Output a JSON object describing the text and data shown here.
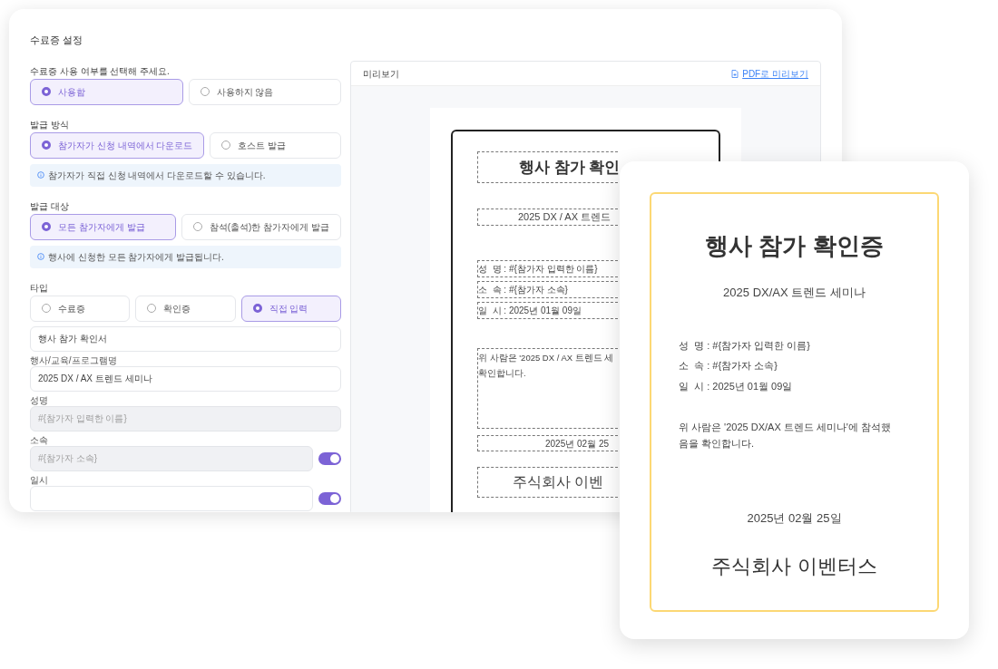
{
  "settings": {
    "title": "수료증 설정",
    "usage": {
      "label": "수료증 사용 여부를 선택해 주세요.",
      "options": [
        {
          "label": "사용함",
          "selected": true
        },
        {
          "label": "사용하지 않음",
          "selected": false
        }
      ]
    },
    "method": {
      "label": "발급 방식",
      "options": [
        {
          "label": "참가자가 신청 내역에서 다운로드",
          "selected": true
        },
        {
          "label": "호스트 발급",
          "selected": false
        }
      ],
      "info": "참가자가 직접 신청 내역에서 다운로드할 수 있습니다."
    },
    "target": {
      "label": "발급 대상",
      "options": [
        {
          "label": "모든 참가자에게 발급",
          "selected": true
        },
        {
          "label": "참석(출석)한 참가자에게 발급",
          "selected": false
        }
      ],
      "info": "행사에 신청한 모든 참가자에게 발급됩니다."
    },
    "type": {
      "label": "타입",
      "options": [
        {
          "label": "수료증",
          "selected": false
        },
        {
          "label": "확인증",
          "selected": false
        },
        {
          "label": "직접 입력",
          "selected": true
        }
      ]
    },
    "fields": [
      {
        "value": "행사 참가 확인서",
        "disabled": false
      },
      {
        "label": "행사/교육/프로그램명",
        "value": "2025 DX / AX 트렌드 세미나",
        "disabled": false
      },
      {
        "label": "성명",
        "placeholder": "#{참가자 입력한 이름}",
        "disabled": true
      },
      {
        "label": "소속",
        "placeholder": "#{참가자 소속}",
        "disabled": true,
        "toggle_on": true
      },
      {
        "label": "일시",
        "disabled": false,
        "toggle_on": true
      }
    ]
  },
  "preview": {
    "title": "미리보기",
    "pdf_link": "PDF로 미리보기",
    "document": {
      "title": "행사 참가 확인",
      "program": "2025 DX / AX 트렌드",
      "lines": [
        "성  명 : #{참가자 입력한 이름}",
        "소  속 : #{참가자 소속}",
        "일  시 : 2025년 01월 09일"
      ],
      "body": [
        "위 사람은 '2025 DX / AX 트렌드 세",
        "확인합니다."
      ],
      "date": "2025년 02월 25",
      "issuer": "주식회사 이벤"
    }
  },
  "certificate": {
    "title": "행사 참가 확인증",
    "program": "2025 DX/AX 트렌드 세미나",
    "lines": [
      "성  명 : #{참가자 입력한 이름}",
      "소  속 : #{참가자 소속}",
      "일  시 : 2025년 01월 09일"
    ],
    "body": "위 사람은 '2025 DX/AX 트렌드 세미나'에 참석했음을 확인합니다.",
    "date": "2025년 02월 25일",
    "issuer": "주식회사 이벤터스"
  }
}
